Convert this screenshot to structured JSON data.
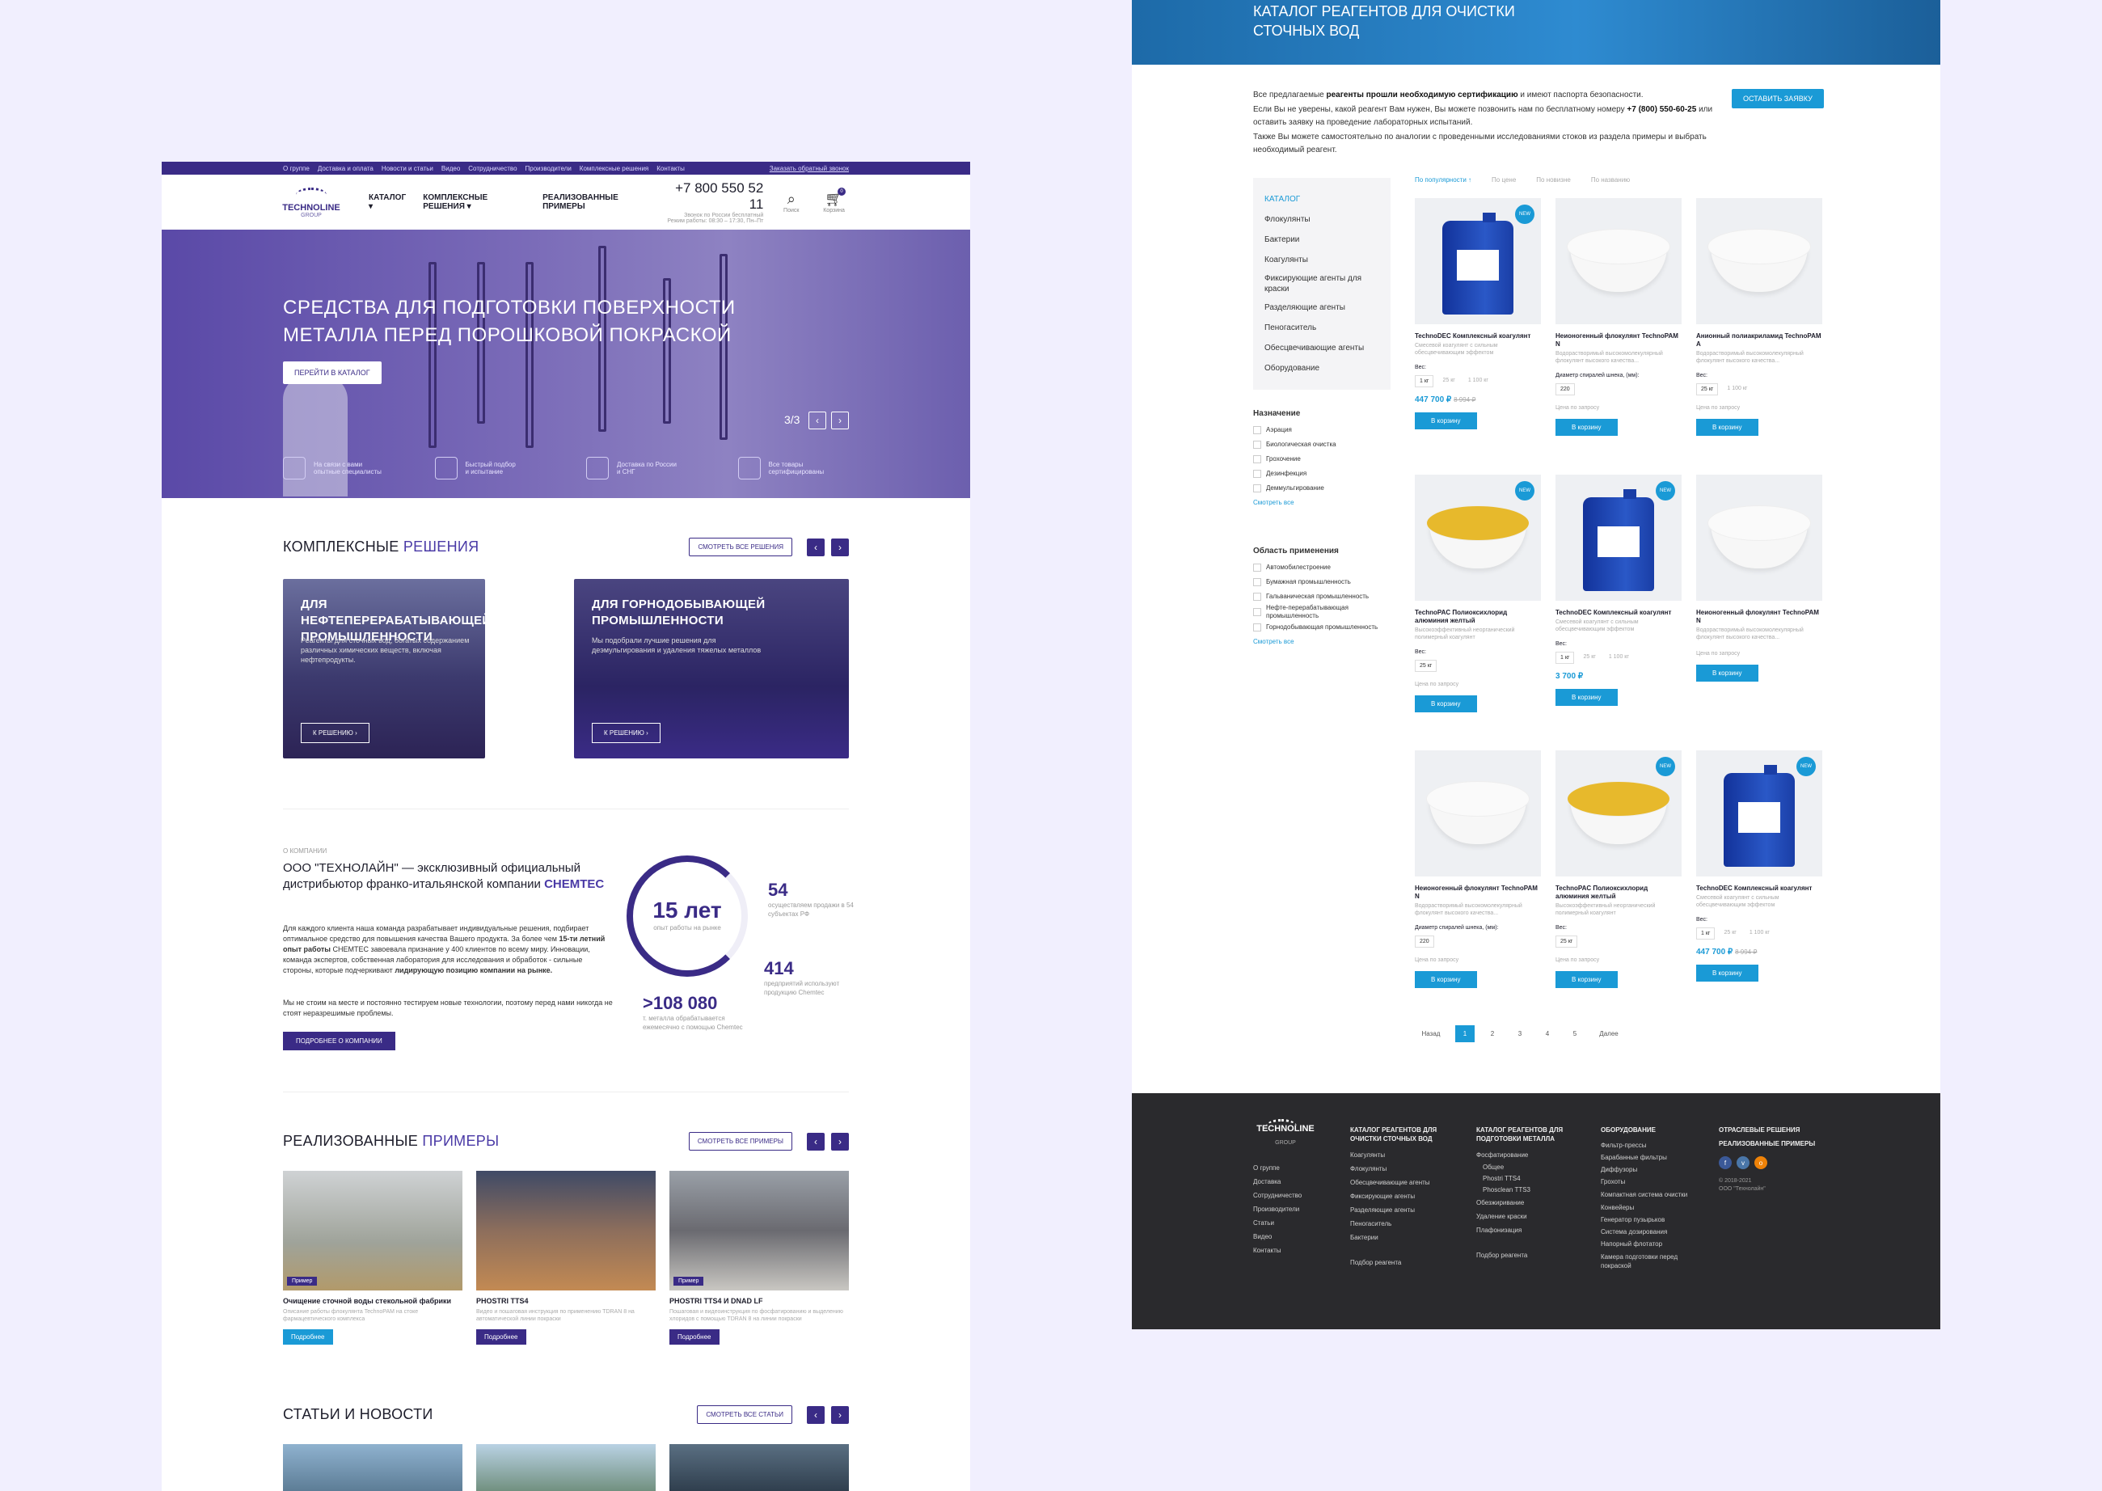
{
  "left": {
    "topbar": {
      "links": [
        "О группе",
        "Доставка и оплата",
        "Новости и статьи",
        "Видео",
        "Сотрудничество",
        "Производители",
        "Комплексные решения",
        "Контакты"
      ],
      "callback": "Заказать обратный звонок"
    },
    "header": {
      "logo": "TECHNOLINE",
      "logo_sub": "GROUP",
      "nav": [
        "КАТАЛОГ",
        "КОМПЛЕКСНЫЕ РЕШЕНИЯ",
        "РЕАЛИЗОВАННЫЕ ПРИМЕРЫ"
      ],
      "phone": "+7 800 550 52 11",
      "phone_sub1": "Звонок по России бесплатный",
      "phone_sub2": "Режим работы: 08:30 – 17:30, Пн–Пт",
      "search": "Поиск",
      "cart": "Корзина",
      "cart_count": "0"
    },
    "hero": {
      "title1": "СРЕДСТВА ДЛЯ ПОДГОТОВКИ ПОВЕРХНОСТИ",
      "title2": "МЕТАЛЛА ПЕРЕД ПОРОШКОВОЙ ПОКРАСКОЙ",
      "button": "ПЕРЕЙТИ В КАТАЛОГ",
      "counter": "3/3",
      "features": [
        {
          "l1": "На связи с вами",
          "l2": "опытные специалисты"
        },
        {
          "l1": "Быстрый подбор",
          "l2": "и испытание"
        },
        {
          "l1": "Доставка по России",
          "l2": "и СНГ"
        },
        {
          "l1": "Все товары",
          "l2": "сертифицированы"
        }
      ]
    },
    "solutions": {
      "t1": "КОМПЛЕКСНЫЕ",
      "t2": "РЕШЕНИЯ",
      "all": "СМОТРЕТЬ ВСЕ РЕШЕНИЯ",
      "cards": [
        {
          "title": "ДЛЯ НЕФТЕПЕРЕРАБАТЫВАЮЩЕЙ ПРОМЫШЛЕННОСТИ",
          "text": "Реагенты для сточных вод, богатых содержанием различных химических веществ, включая нефтепродукты.",
          "btn": "К РЕШЕНИЮ"
        },
        {
          "title": "ДЛЯ ГОРНОДОБЫВАЮЩЕЙ ПРОМЫШЛЕННОСТИ",
          "text": "Мы подобрали лучшие решения для деэмульгирования и удаления тяжелых металлов",
          "btn": "К РЕШЕНИЮ"
        }
      ]
    },
    "about": {
      "kicker": "О КОМПАНИИ",
      "h1": "ООО \"ТЕХНОЛАЙН\" — эксклюзивный официальный",
      "h2": "дистрибьютор франко-итальянской компании",
      "h3": "CHEMTEC",
      "p1a": "Для каждого клиента наша команда разрабатывает индивидуальные решения, подбирает оптимальное средство для повышения качества Вашего продукта. За более чем",
      "p1b": "15-ти летний опыт работы",
      "p1c": "CHEMTEC завоевала признание у 400 клиентов по всему миру. Инновации, команда экспертов, собственная лаборатория для исследования и обработок - сильные стороны, которые подчеркивают",
      "p1d": "лидирующую позицию компании на рынке.",
      "p2": "Мы не стоим на месте и постоянно тестируем новые технологии, поэтому перед нами никогда не стоят неразрешимые проблемы.",
      "btn": "ПОДРОБНЕЕ О КОМПАНИИ",
      "years": "15 лет",
      "years_sub": "опыт работы на рынке",
      "s1": "54",
      "s1t": "осуществляем продажи в 54 субъектах РФ",
      "s2": "414",
      "s2t": "предприятий используют продукцию Chemtec",
      "s3": ">108 080",
      "s3t": "т. металла обрабатывается ежемесячно с помощью Chemtec"
    },
    "examples": {
      "t1": "РЕАЛИЗОВАННЫЕ",
      "t2": "ПРИМЕРЫ",
      "all": "СМОТРЕТЬ ВСЕ ПРИМЕРЫ",
      "items": [
        {
          "tag": "Пример",
          "title": "Очищение сточной воды стекольной фабрики",
          "desc": "Описание работы флокулянта TechnoPAM на стоке фармацевтического комплекса",
          "btn": "Подробнее"
        },
        {
          "tag": "Пример",
          "title": "PHOSTRI TTS4",
          "desc": "Видео и пошаговая инструкция по применению TDRAN 8 на автоматической линии покраски",
          "btn": "Подробнее"
        },
        {
          "tag": "Пример",
          "title": "PHOSTRI TTS4 И DNAD LF",
          "desc": "Пошаговая и видеоинструкция по фосфатированию и выделению хлоридов с помощью TDRAN 8 на линии покраски",
          "btn": "Подробнее"
        }
      ]
    },
    "news": {
      "t1": "СТАТЬИ И НОВОСТИ",
      "all": "СМОТРЕТЬ ВСЕ СТАТЬИ"
    }
  },
  "right": {
    "hero": {
      "t1": "КАТАЛОГ РЕАГЕНТОВ ДЛЯ ОЧИСТКИ",
      "t2": "СТОЧНЫХ ВОД"
    },
    "intro": {
      "a": "Все предлагаемые",
      "b": "реагенты прошли необходимую сертификацию",
      "c": "и имеют паспорта безопасности.",
      "d": "Если Вы не уверены, какой реагент Вам нужен, Вы можете позвонить нам по бесплатному номеру",
      "e": "+7 (800) 550-60-25",
      "f": "или оставить заявку на проведение лабораторных испытаний.",
      "g": "Также Вы можете самостоятельно по аналогии с проведенными исследованиями стоков из раздела примеры и выбрать необходимый реагент.",
      "btn": "ОСТАВИТЬ ЗАЯВКУ"
    },
    "sidebar": {
      "catalog": [
        "КАТАЛОГ",
        "Флокулянты",
        "Бактерии",
        "Коагулянты",
        "Фиксирующие агенты для краски",
        "Разделяющие агенты",
        "Пеногаситель",
        "Обесцвечивающие агенты",
        "Оборудование"
      ],
      "f1": {
        "title": "Назначение",
        "opts": [
          "Аэрация",
          "Биологическая очистка",
          "Грохочение",
          "Дезинфекция",
          "Деммульгирование"
        ],
        "more": "Смотреть все"
      },
      "f2": {
        "title": "Область применения",
        "opts": [
          "Автомобилестроение",
          "Бумажная промышленность",
          "Гальваническая промышленность",
          "Нефте-перерабатывающая промышленность",
          "Горнодобывающая промышленность"
        ],
        "more": "Смотреть все"
      }
    },
    "sort": [
      "По популярности ↑",
      "По цене",
      "По новизне",
      "По названию"
    ],
    "products": [
      {
        "kind": "jar",
        "new": "NEW",
        "name": "TechnoDEC Комплексный коагулянт",
        "desc": "Смесевой коагулянт с сильным обесцвечивающим эффектом",
        "label": "Вес:",
        "opts": [
          "1 кг",
          "25 кг",
          "1 100 кг"
        ],
        "price": "447 700 ₽",
        "old": "8 994 ₽",
        "btn": "В корзину"
      },
      {
        "kind": "white",
        "new": "",
        "name": "Неионогенный флокулянт TechnoPAM N",
        "desc": "Водорастворимый высокомолекулярный флокулянт высокого качества...",
        "label": "Диаметр спиралей шнека, (мм):",
        "opts": [
          "220"
        ],
        "price": "",
        "quote": "Цена по запросу",
        "btn": "В корзину"
      },
      {
        "kind": "white",
        "new": "",
        "name": "Анионный полиакриламид TechnoPAM A",
        "desc": "Водорастворимый высокомолекулярный флокулянт высокого качества...",
        "label": "Вес:",
        "opts": [
          "25 кг",
          "1 100 кг"
        ],
        "price": "",
        "quote": "Цена по запросу",
        "btn": "В корзину"
      },
      {
        "kind": "yellow",
        "new": "NEW",
        "name": "TechnoPAC Полиоксихлорид алюминия желтый",
        "desc": "Высокоэффективный неорганический полимерный коагулянт",
        "label": "Вес:",
        "opts": [
          "25 кг"
        ],
        "price": "",
        "quote": "Цена по запросу",
        "btn": "В корзину"
      },
      {
        "kind": "jar",
        "new": "NEW",
        "name": "TechnoDEC Комплексный коагулянт",
        "desc": "Смесевой коагулянт с сильным обесцвечивающим эффектом",
        "label": "Вес:",
        "opts": [
          "1 кг",
          "25 кг",
          "1 100 кг"
        ],
        "price": "3 700 ₽",
        "old": "",
        "btn": "В корзину"
      },
      {
        "kind": "white",
        "new": "",
        "name": "Неионогенный флокулянт TechnoPAM N",
        "desc": "Водорастворимый высокомолекулярный флокулянт высокого качества...",
        "label": "",
        "opts": [],
        "price": "",
        "quote": "Цена по запросу",
        "btn": "В корзину"
      },
      {
        "kind": "white",
        "new": "",
        "name": "Неионогенный флокулянт TechnoPAM N",
        "desc": "Водорастворимый высокомолекулярный флокулянт высокого качества...",
        "label": "Диаметр спиралей шнека, (мм):",
        "opts": [
          "220"
        ],
        "price": "",
        "quote": "Цена по запросу",
        "btn": "В корзину"
      },
      {
        "kind": "yellow",
        "new": "NEW",
        "name": "TechnoPAC Полиоксихлорид алюминия желтый",
        "desc": "Высокоэффективный неорганический полимерный коагулянт",
        "label": "Вес:",
        "opts": [
          "25 кг"
        ],
        "price": "",
        "quote": "Цена по запросу",
        "btn": "В корзину"
      },
      {
        "kind": "jar",
        "new": "NEW",
        "name": "TechnoDEC Комплексный коагулянт",
        "desc": "Смесевой коагулянт с сильным обесцвечивающим эффектом",
        "label": "Вес:",
        "opts": [
          "1 кг",
          "25 кг",
          "1 100 кг"
        ],
        "price": "447 700 ₽",
        "old": "8 994 ₽",
        "btn": "В корзину"
      }
    ],
    "pager": {
      "prev": "Назад",
      "pages": [
        "1",
        "2",
        "3",
        "4",
        "5"
      ],
      "next": "Далее"
    },
    "footer": {
      "logo": "TECHNOLINE",
      "logo_sub": "GROUP",
      "links": [
        "О группе",
        "Доставка",
        "Сотрудничество",
        "Производители",
        "Статьи",
        "Видео",
        "Контакты"
      ],
      "c1": {
        "title": "КАТАЛОГ РЕАГЕНТОВ ДЛЯ ОЧИСТКИ СТОЧНЫХ ВОД",
        "items": [
          "Коагулянты",
          "Флокулянты",
          "Обесцвечивающие агенты",
          "Фиксирующие агенты",
          "Разделяющие агенты",
          "Пеногаситель",
          "Бактерии"
        ],
        "extra": "Подбор реагента"
      },
      "c2": {
        "title": "КАТАЛОГ РЕАГЕНТОВ ДЛЯ ПОДГОТОВКИ МЕТАЛЛА",
        "items": [
          "Фосфатирование",
          "Общее",
          "Phostri TTS4",
          "Phosclean TTS3",
          "Обезжиривание",
          "Удаление краски",
          "Плафонизация"
        ],
        "extra": "Подбор реагента"
      },
      "c3": {
        "title": "ОБОРУДОВАНИЕ",
        "items": [
          "Фильтр-прессы",
          "Барабанные фильтры",
          "Диффузоры",
          "Грохоты",
          "Компактная система очистки",
          "Конвейеры",
          "Генератор пузырьков",
          "Система дозирования",
          "Напорный флотатор",
          "Камера подготовки перед покраской"
        ]
      },
      "c4": {
        "t1": "ОТРАСЛЕВЫЕ РЕШЕНИЯ",
        "t2": "РЕАЛИЗОВАННЫЕ ПРИМЕРЫ",
        "copy1": "© 2018-2021",
        "copy2": "ООО \"Технолайн\""
      }
    }
  }
}
